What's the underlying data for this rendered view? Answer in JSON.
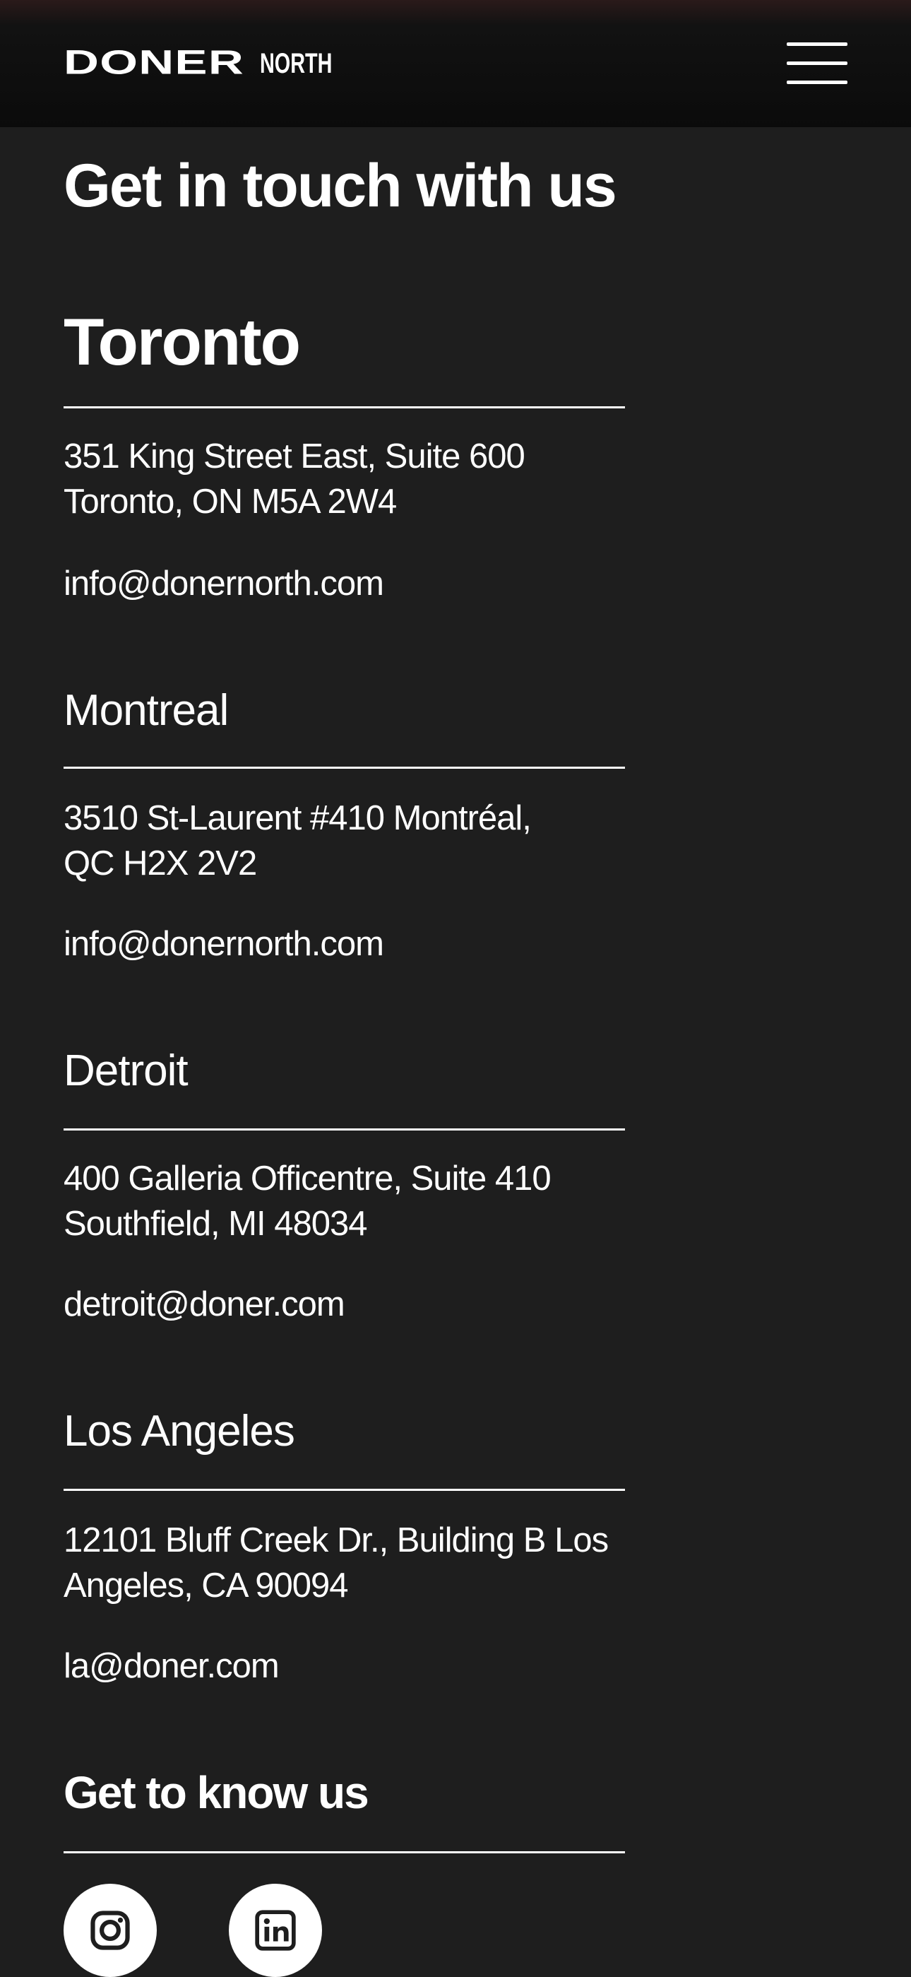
{
  "header": {
    "logo_main": "DONER",
    "logo_sub": "NORTH"
  },
  "page": {
    "title": "Get in touch with us"
  },
  "offices": [
    {
      "city": "Toronto",
      "address_line1": "351 King Street East, Suite 600",
      "address_line2": "Toronto, ON M5A 2W4",
      "email": "info@donernorth.com"
    },
    {
      "city": "Montreal",
      "address_line1": "3510 St-Laurent #410 Montréal,",
      "address_line2": "QC H2X 2V2",
      "email": "info@donernorth.com"
    },
    {
      "city": "Detroit",
      "address_line1": "400 Galleria Officentre, Suite 410",
      "address_line2": "Southfield, MI 48034",
      "email": "detroit@doner.com"
    },
    {
      "city": "Los Angeles",
      "address_line1": "12101 Bluff Creek Dr., Building B Los",
      "address_line2": "Angeles, CA 90094",
      "email": "la@doner.com"
    }
  ],
  "social": {
    "title": "Get to know us",
    "links": [
      {
        "icon": "instagram-icon"
      },
      {
        "icon": "linkedin-icon"
      }
    ]
  },
  "colors": {
    "background": "#1e1e1e",
    "header_background": "#0b0b0b",
    "text": "#ffffff"
  }
}
